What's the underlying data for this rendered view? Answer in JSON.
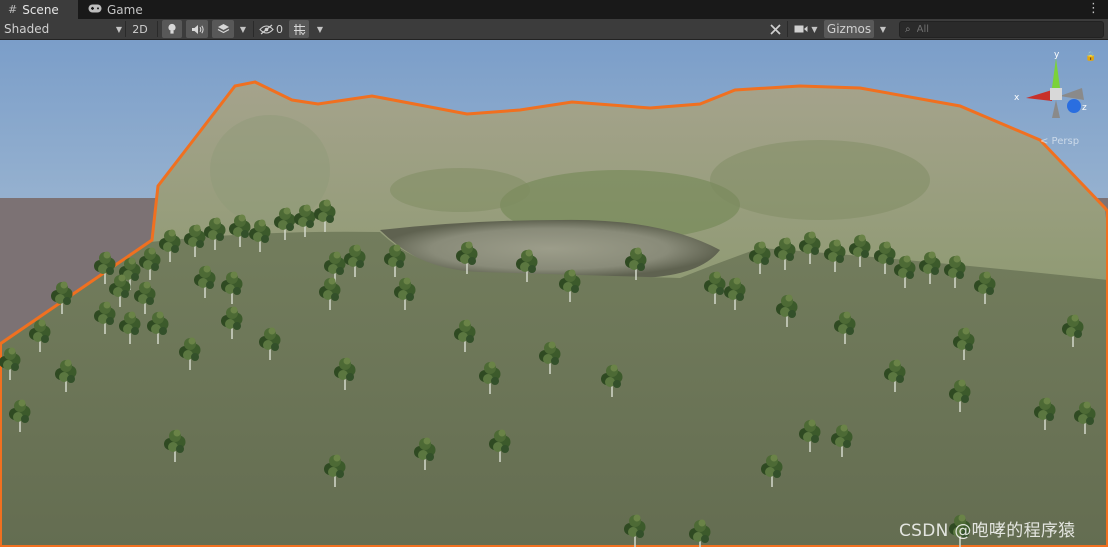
{
  "tabs": [
    {
      "label": "Scene",
      "icon": "grid-icon",
      "active": true
    },
    {
      "label": "Game",
      "icon": "gamepad-icon",
      "active": false
    }
  ],
  "toolbar": {
    "draw_mode": "Shaded",
    "mode_2d": "2D",
    "hidden_count": "0",
    "gizmos_label": "Gizmos",
    "search_placeholder": "All"
  },
  "scene_gizmo": {
    "x_label": "x",
    "y_label": "y",
    "z_label": "z",
    "projection_label": "< Persp"
  },
  "watermark": "CSDN @咆哮的程序猿",
  "colors": {
    "selection_outline": "#f07020",
    "sky_top": "#7c9ecb",
    "terrain": "#6b7557",
    "gizmo_x": "#c8302a",
    "gizmo_y": "#7bd23a",
    "gizmo_z": "#2a6ee0"
  }
}
